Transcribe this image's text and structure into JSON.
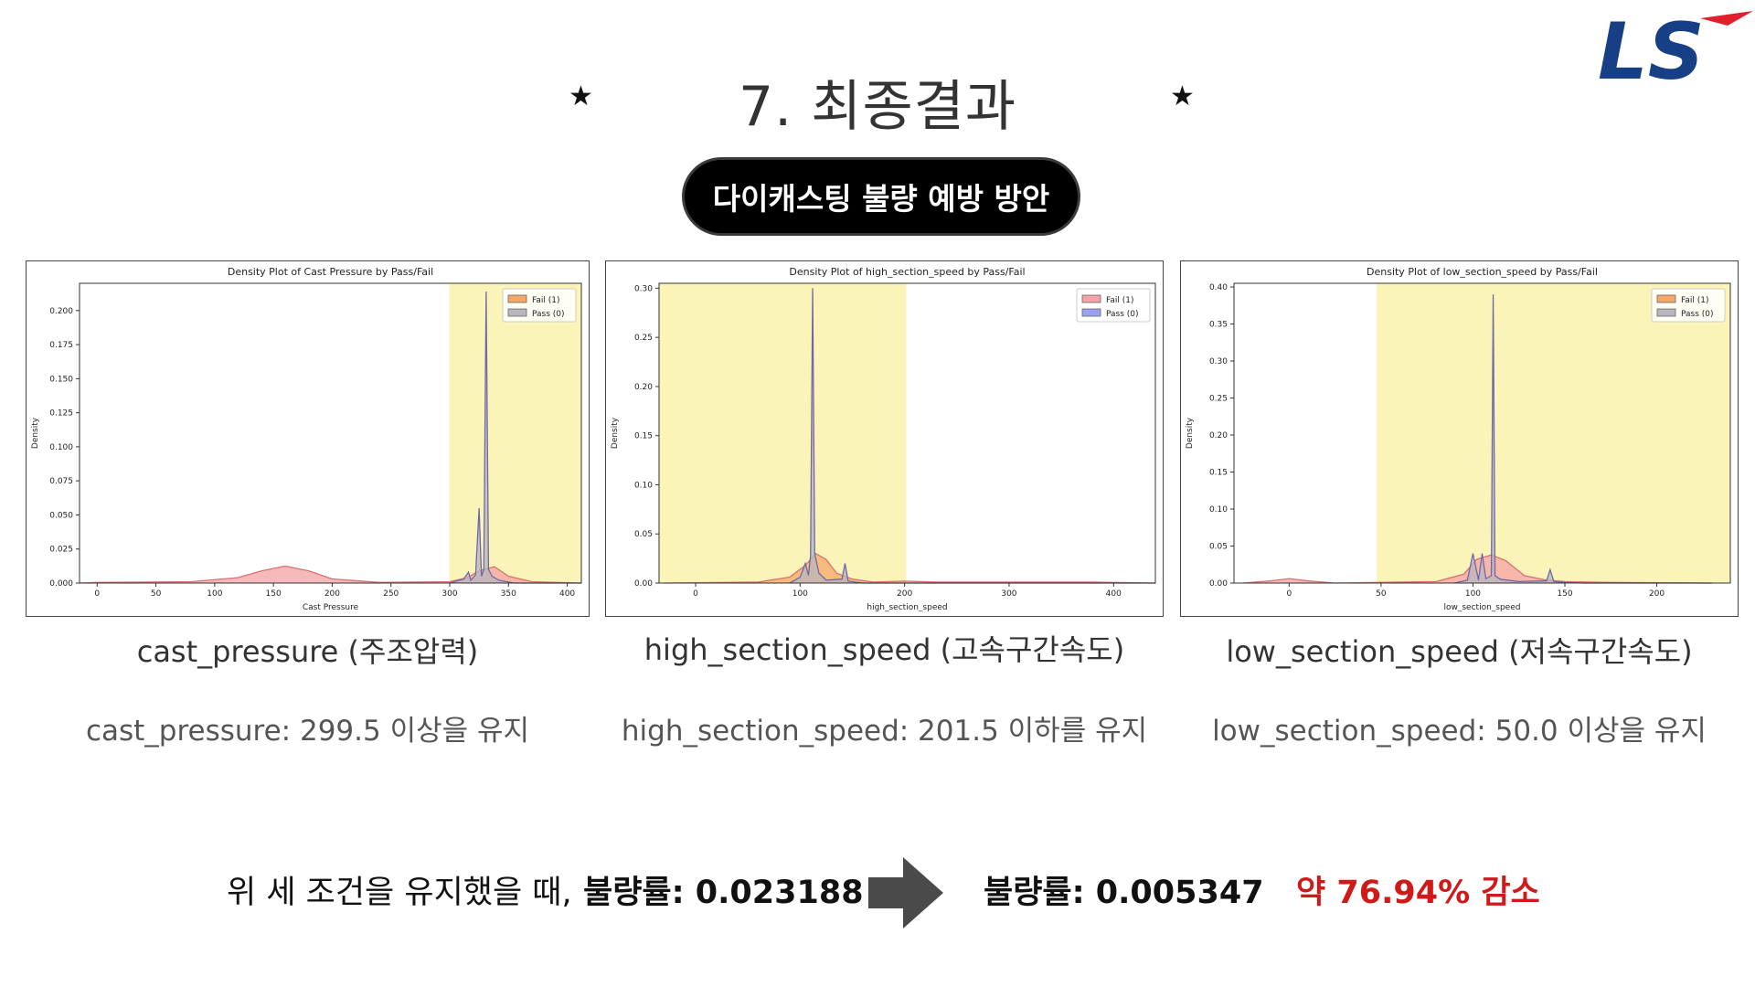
{
  "slide": {
    "title": "7. 최종결과",
    "star_left": "★",
    "star_right": "★",
    "pill": "다이캐스팅 불량 예방 방안",
    "logo_text": "LS"
  },
  "captions": [
    {
      "name": "cast_pressure (주조압력)",
      "condition": "cast_pressure: 299.5 이상을 유지"
    },
    {
      "name": "high_section_speed (고속구간속도)",
      "condition": "high_section_speed: 201.5 이하를 유지"
    },
    {
      "name": "low_section_speed (저속구간속도)",
      "condition": "low_section_speed: 50.0 이상을 유지"
    }
  ],
  "summary": {
    "prefix": "위 세 조건을 유지했을 때,",
    "before": "불량률: 0.023188",
    "after": "불량률: 0.005347",
    "result": "약 76.94% 감소"
  },
  "colors": {
    "fail": "#f4a3a6",
    "fail_orange": "#f5a86a",
    "pass_gray": "#b9b6bd",
    "pass_blue": "#9aa2f0",
    "highlight": "#fbf4b8",
    "line": "#6e6aa8",
    "accent_red": "#d01a1a",
    "logo_blue": "#173f86",
    "logo_red": "#e0202a"
  },
  "chart_data": [
    {
      "type": "area",
      "title": "Density Plot of Cast Pressure by Pass/Fail",
      "xlabel": "Cast Pressure",
      "ylabel": "Density",
      "xlim": [
        -15,
        412
      ],
      "ylim": [
        0,
        0.22
      ],
      "xticks": [
        0,
        50,
        100,
        150,
        200,
        250,
        300,
        350,
        400
      ],
      "yticks": [
        0.0,
        0.025,
        0.05,
        0.075,
        0.1,
        0.125,
        0.15,
        0.175,
        0.2
      ],
      "ytick_labels": [
        "0.000",
        "0.025",
        "0.050",
        "0.075",
        "0.100",
        "0.125",
        "0.150",
        "0.175",
        "0.200"
      ],
      "highlight": [
        299.5,
        412
      ],
      "legend": {
        "position": "top-right",
        "entries": [
          {
            "label": "Fail (1)",
            "color_key": "fail_orange"
          },
          {
            "label": "Pass (0)",
            "color_key": "pass_gray"
          }
        ]
      },
      "series": [
        {
          "name": "Fail (1)",
          "color_key": "fail",
          "points": [
            [
              -15,
              0
            ],
            [
              0,
              0.0005
            ],
            [
              80,
              0.001
            ],
            [
              120,
              0.004
            ],
            [
              140,
              0.009
            ],
            [
              160,
              0.0125
            ],
            [
              180,
              0.009
            ],
            [
              200,
              0.003
            ],
            [
              240,
              0.0005
            ],
            [
              300,
              0.001
            ],
            [
              315,
              0.004
            ],
            [
              325,
              0.009
            ],
            [
              338,
              0.012
            ],
            [
              350,
              0.005
            ],
            [
              370,
              0.001
            ],
            [
              412,
              0
            ]
          ]
        },
        {
          "name": "Pass (0)",
          "color_key": "pass_gray",
          "points": [
            [
              300,
              0
            ],
            [
              312,
              0.003
            ],
            [
              316,
              0.008
            ],
            [
              318,
              0.002
            ],
            [
              322,
              0.006
            ],
            [
              325,
              0.055
            ],
            [
              327,
              0.005
            ],
            [
              329,
              0.01
            ],
            [
              331,
              0.214
            ],
            [
              333,
              0.01
            ],
            [
              336,
              0.005
            ],
            [
              342,
              0.002
            ],
            [
              355,
              0
            ],
            [
              412,
              0
            ]
          ]
        }
      ]
    },
    {
      "type": "area",
      "title": "Density Plot of high_section_speed by Pass/Fail",
      "xlabel": "high_section_speed",
      "ylabel": "Density",
      "xlim": [
        -35,
        440
      ],
      "ylim": [
        0,
        0.305
      ],
      "xticks": [
        0,
        100,
        200,
        300,
        400
      ],
      "yticks": [
        0.0,
        0.05,
        0.1,
        0.15,
        0.2,
        0.25,
        0.3
      ],
      "ytick_labels": [
        "0.00",
        "0.05",
        "0.10",
        "0.15",
        "0.20",
        "0.25",
        "0.30"
      ],
      "highlight": [
        -35,
        201.5
      ],
      "legend": {
        "position": "top-right",
        "entries": [
          {
            "label": "Fail (1)",
            "color_key": "fail"
          },
          {
            "label": "Pass (0)",
            "color_key": "pass_blue"
          }
        ]
      },
      "series": [
        {
          "name": "Fail (1)",
          "color_key": "fail_orange",
          "points": [
            [
              -30,
              0
            ],
            [
              60,
              0.001
            ],
            [
              90,
              0.006
            ],
            [
              105,
              0.018
            ],
            [
              115,
              0.03
            ],
            [
              125,
              0.024
            ],
            [
              135,
              0.01
            ],
            [
              150,
              0.004
            ],
            [
              170,
              0.001
            ],
            [
              200,
              0.002
            ],
            [
              230,
              0.001
            ],
            [
              380,
              0.001
            ],
            [
              440,
              0
            ]
          ]
        },
        {
          "name": "Pass (0)",
          "color_key": "pass_gray",
          "points": [
            [
              90,
              0
            ],
            [
              100,
              0.006
            ],
            [
              105,
              0.02
            ],
            [
              108,
              0.008
            ],
            [
              110,
              0.028
            ],
            [
              112,
              0.3
            ],
            [
              114,
              0.03
            ],
            [
              118,
              0.01
            ],
            [
              125,
              0.003
            ],
            [
              140,
              0.004
            ],
            [
              143,
              0.02
            ],
            [
              146,
              0.002
            ],
            [
              160,
              0
            ],
            [
              440,
              0
            ]
          ]
        }
      ]
    },
    {
      "type": "area",
      "title": "Density Plot of low_section_speed by Pass/Fail",
      "xlabel": "low_section_speed",
      "ylabel": "Density",
      "xlim": [
        -30,
        240
      ],
      "ylim": [
        0,
        0.405
      ],
      "xticks": [
        0,
        50,
        100,
        150,
        200
      ],
      "yticks": [
        0.0,
        0.05,
        0.1,
        0.15,
        0.2,
        0.25,
        0.3,
        0.35,
        0.4
      ],
      "ytick_labels": [
        "0.00",
        "0.05",
        "0.10",
        "0.15",
        "0.20",
        "0.25",
        "0.30",
        "0.35",
        "0.40"
      ],
      "highlight": [
        47.5,
        240
      ],
      "legend": {
        "position": "top-right",
        "entries": [
          {
            "label": "Fail (1)",
            "color_key": "fail_orange"
          },
          {
            "label": "Pass (0)",
            "color_key": "pass_gray"
          }
        ]
      },
      "series": [
        {
          "name": "Fail (1)",
          "color_key": "fail",
          "points": [
            [
              -25,
              0
            ],
            [
              -10,
              0.003
            ],
            [
              0,
              0.006
            ],
            [
              10,
              0.003
            ],
            [
              25,
              0
            ],
            [
              80,
              0.002
            ],
            [
              95,
              0.012
            ],
            [
              102,
              0.032
            ],
            [
              110,
              0.038
            ],
            [
              118,
              0.03
            ],
            [
              128,
              0.01
            ],
            [
              140,
              0.004
            ],
            [
              150,
              0.002
            ],
            [
              170,
              0.001
            ],
            [
              230,
              0
            ]
          ]
        },
        {
          "name": "Pass (0)",
          "color_key": "pass_gray",
          "points": [
            [
              90,
              0
            ],
            [
              97,
              0.004
            ],
            [
              100,
              0.04
            ],
            [
              103,
              0.004
            ],
            [
              105,
              0.04
            ],
            [
              107,
              0.006
            ],
            [
              110,
              0.01
            ],
            [
              111,
              0.39
            ],
            [
              112,
              0.01
            ],
            [
              115,
              0.005
            ],
            [
              125,
              0.002
            ],
            [
              140,
              0.003
            ],
            [
              142,
              0.018
            ],
            [
              144,
              0.002
            ],
            [
              150,
              0.001
            ],
            [
              160,
              0
            ],
            [
              230,
              0
            ]
          ]
        }
      ]
    }
  ]
}
